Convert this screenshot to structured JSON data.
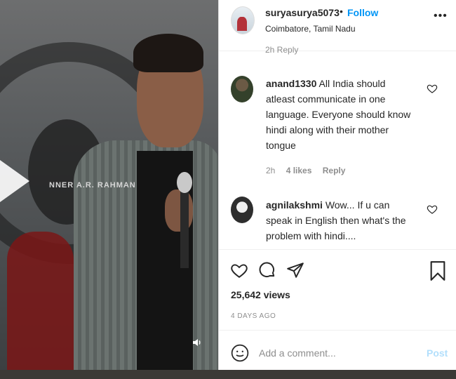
{
  "video": {
    "banner_text": "NNER A.R. RAHMAN"
  },
  "post": {
    "username": "suryasurya5073",
    "separator": "•",
    "follow_label": "Follow",
    "location": "Coimbatore, Tamil Nadu",
    "more_label": "•••"
  },
  "partial_meta": "2h Reply",
  "comments": [
    {
      "username": "anand1330",
      "text": "All India should atleast communicate in one language. Everyone should know hindi along with their mother tongue",
      "time": "2h",
      "likes": "4 likes",
      "reply": "Reply"
    },
    {
      "username": "agnilakshmi",
      "text": "Wow... If u can speak in English then what's the problem with hindi...."
    }
  ],
  "stats": {
    "views": "25,642 views",
    "posted": "4 DAYS AGO"
  },
  "composer": {
    "placeholder": "Add a comment...",
    "post_label": "Post"
  },
  "colors": {
    "accent": "#0095f6",
    "post_disabled": "#b2dffc",
    "text": "#262626",
    "muted": "#8e8e8e"
  },
  "icons": [
    "play-icon",
    "volume-icon",
    "more-icon",
    "heart-icon",
    "comment-icon",
    "share-icon",
    "bookmark-icon",
    "emoji-icon"
  ]
}
